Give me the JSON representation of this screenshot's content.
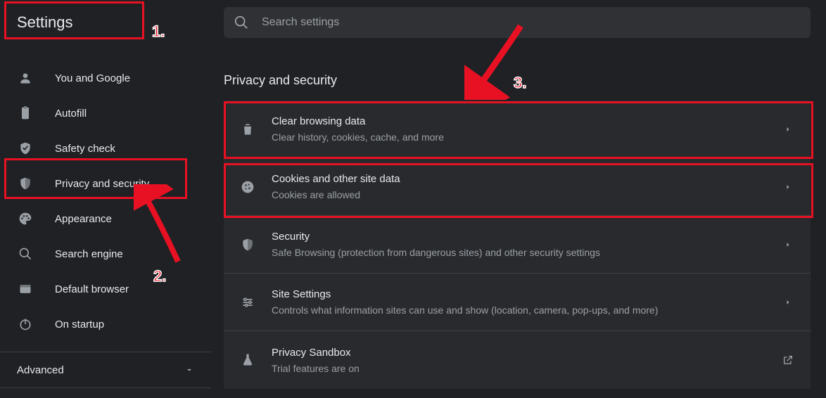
{
  "header": {
    "title": "Settings"
  },
  "search": {
    "placeholder": "Search settings"
  },
  "sidebar": {
    "items": [
      {
        "label": "You and Google"
      },
      {
        "label": "Autofill"
      },
      {
        "label": "Safety check"
      },
      {
        "label": "Privacy and security"
      },
      {
        "label": "Appearance"
      },
      {
        "label": "Search engine"
      },
      {
        "label": "Default browser"
      },
      {
        "label": "On startup"
      }
    ],
    "advanced_label": "Advanced"
  },
  "main": {
    "section_title": "Privacy and security",
    "rows": [
      {
        "title": "Clear browsing data",
        "sub": "Clear history, cookies, cache, and more"
      },
      {
        "title": "Cookies and other site data",
        "sub": "Cookies are allowed"
      },
      {
        "title": "Security",
        "sub": "Safe Browsing (protection from dangerous sites) and other security settings"
      },
      {
        "title": "Site Settings",
        "sub": "Controls what information sites can use and show (location, camera, pop-ups, and more)"
      },
      {
        "title": "Privacy Sandbox",
        "sub": "Trial features are on"
      }
    ]
  },
  "annotations": {
    "l1": "1.",
    "l2": "2.",
    "l3": "3."
  }
}
